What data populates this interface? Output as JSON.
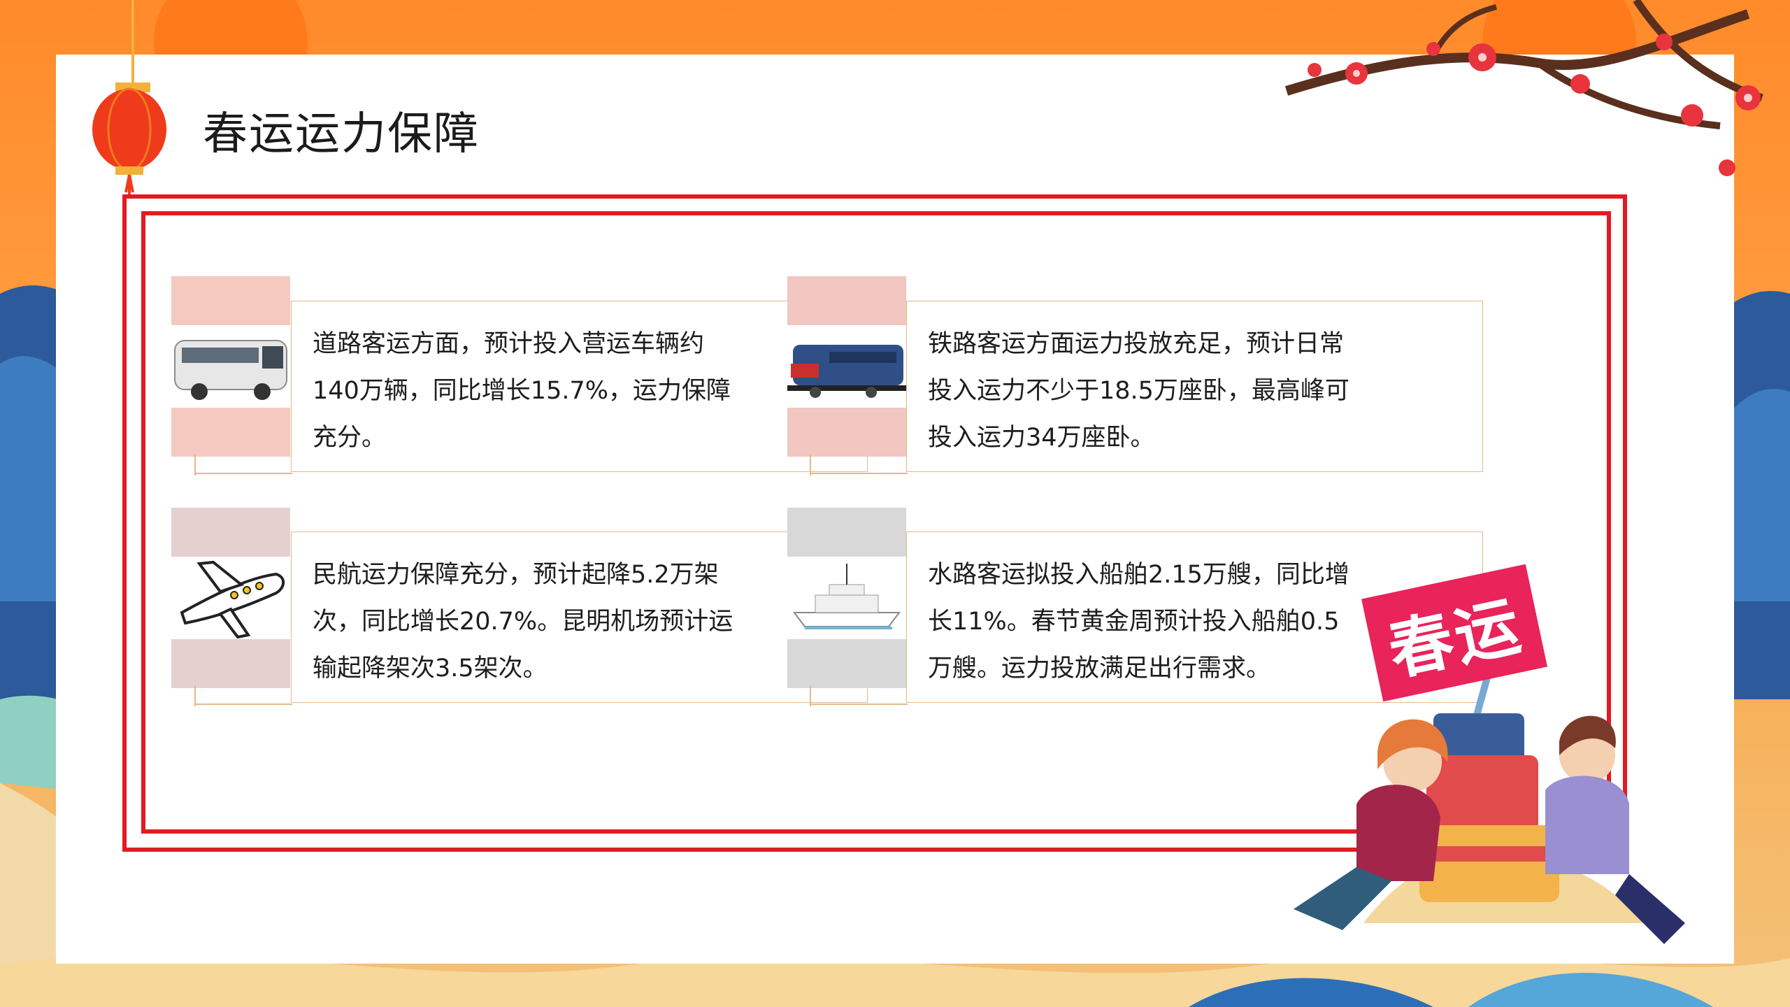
{
  "slide": {
    "title": "春运运力保障",
    "badge_text": "春运",
    "cards": [
      {
        "icon": "bus-icon",
        "text": "道路客运方面，预计投入营运车辆约140万辆，同比增长15.7%，运力保障充分。"
      },
      {
        "icon": "train-icon",
        "text": "铁路客运方面运力投放充足，预计日常投入运力不少于18.5万座卧，最高峰可投入运力34万座卧。"
      },
      {
        "icon": "airplane-icon",
        "text": "民航运力保障充分，预计起降5.2万架次，同比增长20.7%。昆明机场预计运输起降架次3.5架次。"
      },
      {
        "icon": "ship-icon",
        "text": "水路客运拟投入船舶2.15万艘，同比增长11%。春节黄金周预计投入船舶0.5万艘。运力投放满足出行需求。"
      }
    ]
  },
  "colors": {
    "accent_red": "#e21b23",
    "card_border": "#e3b98a",
    "bg_orange": "#ff8a2a"
  }
}
